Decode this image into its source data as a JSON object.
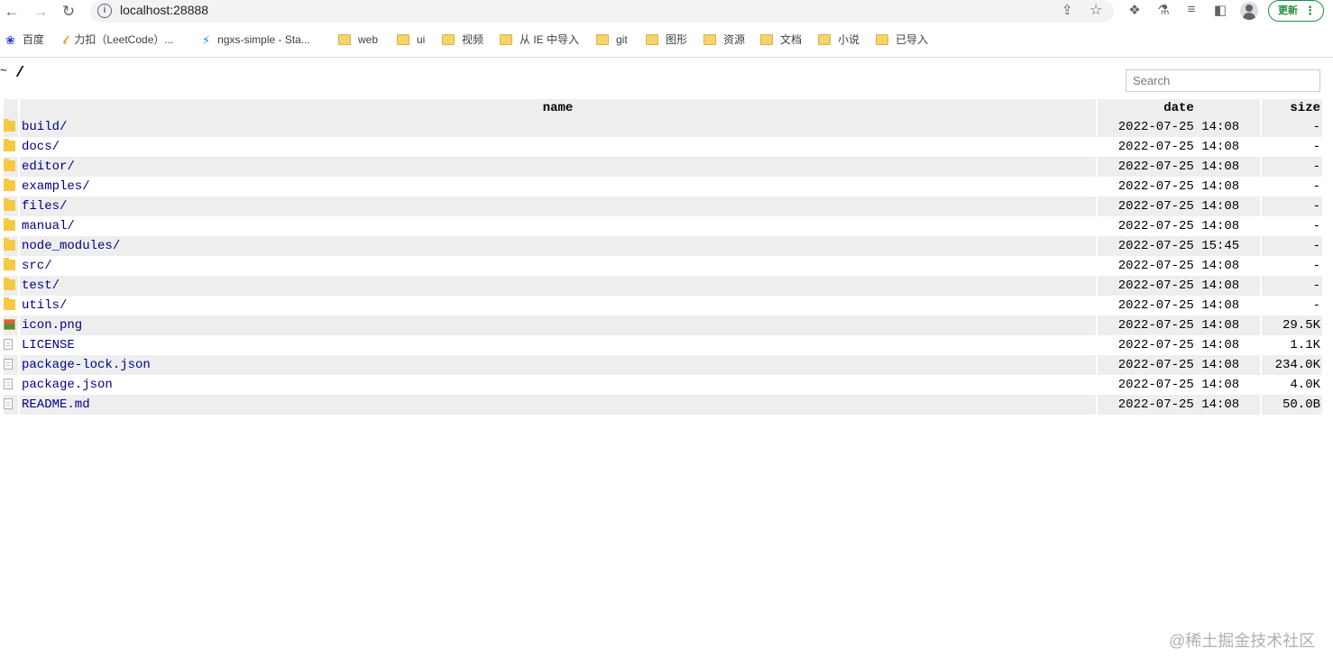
{
  "browser": {
    "url": "localhost:28888",
    "update_label": "更新",
    "bookmarks": [
      {
        "label": "百度",
        "icon": "baidu-paw-icon"
      },
      {
        "label": "力扣（LeetCode）...",
        "icon": "leetcode-icon"
      },
      {
        "label": "ngxs-simple - Sta...",
        "icon": "stackblitz-bolt-icon"
      },
      {
        "label": "web",
        "icon": "folder-icon"
      },
      {
        "label": "ui",
        "icon": "folder-icon"
      },
      {
        "label": "视频",
        "icon": "folder-icon"
      },
      {
        "label": "从 IE 中导入",
        "icon": "folder-icon"
      },
      {
        "label": "git",
        "icon": "folder-icon"
      },
      {
        "label": "图形",
        "icon": "folder-icon"
      },
      {
        "label": "资源",
        "icon": "folder-icon"
      },
      {
        "label": "文档",
        "icon": "folder-icon"
      },
      {
        "label": "小说",
        "icon": "folder-icon"
      },
      {
        "label": "已导入",
        "icon": "folder-icon"
      }
    ]
  },
  "page": {
    "tilde": "~",
    "path": "/",
    "search_placeholder": "Search",
    "columns": {
      "name": "name",
      "date": "date",
      "size": "size"
    },
    "files": [
      {
        "name": "build/",
        "date": "2022-07-25 14:08",
        "size": "-",
        "icon": "folder-icon"
      },
      {
        "name": "docs/",
        "date": "2022-07-25 14:08",
        "size": "-",
        "icon": "folder-icon"
      },
      {
        "name": "editor/",
        "date": "2022-07-25 14:08",
        "size": "-",
        "icon": "folder-icon"
      },
      {
        "name": "examples/",
        "date": "2022-07-25 14:08",
        "size": "-",
        "icon": "folder-icon"
      },
      {
        "name": "files/",
        "date": "2022-07-25 14:08",
        "size": "-",
        "icon": "folder-icon"
      },
      {
        "name": "manual/",
        "date": "2022-07-25 14:08",
        "size": "-",
        "icon": "folder-icon"
      },
      {
        "name": "node_modules/",
        "date": "2022-07-25 15:45",
        "size": "-",
        "icon": "folder-icon"
      },
      {
        "name": "src/",
        "date": "2022-07-25 14:08",
        "size": "-",
        "icon": "folder-icon"
      },
      {
        "name": "test/",
        "date": "2022-07-25 14:08",
        "size": "-",
        "icon": "folder-icon"
      },
      {
        "name": "utils/",
        "date": "2022-07-25 14:08",
        "size": "-",
        "icon": "folder-icon"
      },
      {
        "name": "icon.png",
        "date": "2022-07-25 14:08",
        "size": "29.5K",
        "icon": "image-file-icon"
      },
      {
        "name": "LICENSE",
        "date": "2022-07-25 14:08",
        "size": "1.1K",
        "icon": "file-icon"
      },
      {
        "name": "package-lock.json",
        "date": "2022-07-25 14:08",
        "size": "234.0K",
        "icon": "file-icon"
      },
      {
        "name": "package.json",
        "date": "2022-07-25 14:08",
        "size": "4.0K",
        "icon": "file-icon"
      },
      {
        "name": "README.md",
        "date": "2022-07-25 14:08",
        "size": "50.0B",
        "icon": "file-icon"
      }
    ]
  },
  "watermark": "@稀土掘金技术社区",
  "colors": {
    "link": "#00008b",
    "stripe": "#eeeeee",
    "update_green": "#1e8e3e"
  }
}
